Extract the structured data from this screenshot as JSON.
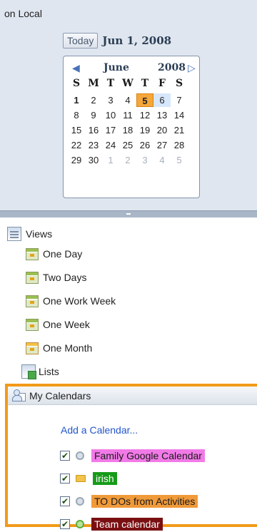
{
  "header": {
    "title": "on Local"
  },
  "today": {
    "button_label": "Today",
    "date": "Jun 1, 2008"
  },
  "mini_calendar": {
    "month": "June",
    "year": "2008",
    "prev_arrow": "◀",
    "next_arrow": "▷",
    "weekdays": [
      "S",
      "M",
      "T",
      "W",
      "T",
      "F",
      "S"
    ],
    "weeks": [
      [
        "1",
        "2",
        "3",
        "4",
        "5",
        "6",
        "7"
      ],
      [
        "8",
        "9",
        "10",
        "11",
        "12",
        "13",
        "14"
      ],
      [
        "15",
        "16",
        "17",
        "18",
        "19",
        "20",
        "21"
      ],
      [
        "22",
        "23",
        "24",
        "25",
        "26",
        "27",
        "28"
      ],
      [
        "29",
        "30",
        "1",
        "2",
        "3",
        "4",
        "5"
      ]
    ],
    "selected_day": "5"
  },
  "views": {
    "header": "Views",
    "items": [
      {
        "label": "One Day",
        "icon": "day-view-icon"
      },
      {
        "label": "Two Days",
        "icon": "two-days-view-icon"
      },
      {
        "label": "One Work Week",
        "icon": "work-week-view-icon"
      },
      {
        "label": "One Week",
        "icon": "week-view-icon"
      },
      {
        "label": "One Month",
        "icon": "month-view-icon"
      }
    ],
    "lists_label": "Lists"
  },
  "my_calendars": {
    "header": "My Calendars",
    "add_label": "Add a Calendar...",
    "calendars": [
      {
        "name": "Family Google Calendar",
        "checked": true,
        "icon": "globe-icon",
        "color": "#f27ae8",
        "text_color": "#1a1a1a"
      },
      {
        "name": "irish",
        "checked": true,
        "icon": "folder-icon",
        "color": "#169b18",
        "text_color": "#ffffff"
      },
      {
        "name": "TO DOs from Activities",
        "checked": true,
        "icon": "globe-icon",
        "color": "#f09a3a",
        "text_color": "#1a1a1a"
      },
      {
        "name": "Team calendar",
        "checked": true,
        "icon": "globe-icon",
        "color": "#7a0f12",
        "text_color": "#ffffff"
      }
    ],
    "highlight_color": "#f29a19"
  }
}
